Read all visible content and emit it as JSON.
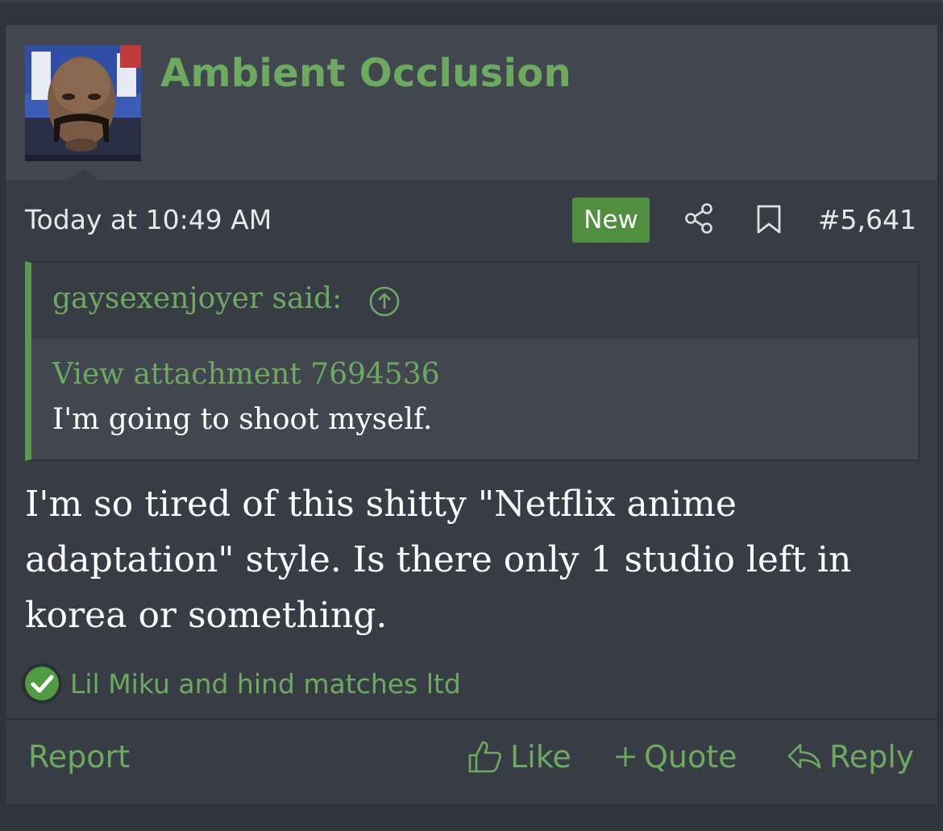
{
  "post": {
    "username": "Ambient Occlusion",
    "date": "Today at 10:49 AM",
    "new_badge": "New",
    "post_number": "#5,641",
    "quote": {
      "author": "gaysexenjoyer said:",
      "attachment": "View attachment 7694536",
      "text": "I'm going to shoot myself."
    },
    "body": "I'm so tired of this shitty \"Netflix anime adaptation\" style. Is there only 1 studio left in korea or something.",
    "reactions": "Lil Miku and hind matches ltd",
    "actions": {
      "report": "Report",
      "like": "Like",
      "quote": "Quote",
      "reply": "Reply"
    }
  },
  "icons": {
    "share": "share-icon",
    "bookmark": "bookmark-icon",
    "quote_up": "arrow-up-circle-icon",
    "reaction": "check-circle-icon",
    "like": "thumbs-up-icon",
    "quote": "plus-icon",
    "reply": "reply-arrow-icon"
  },
  "colors": {
    "accent": "#6cab5f",
    "badge": "#4f8f3f",
    "background": "#383c45",
    "header": "#41464f"
  }
}
